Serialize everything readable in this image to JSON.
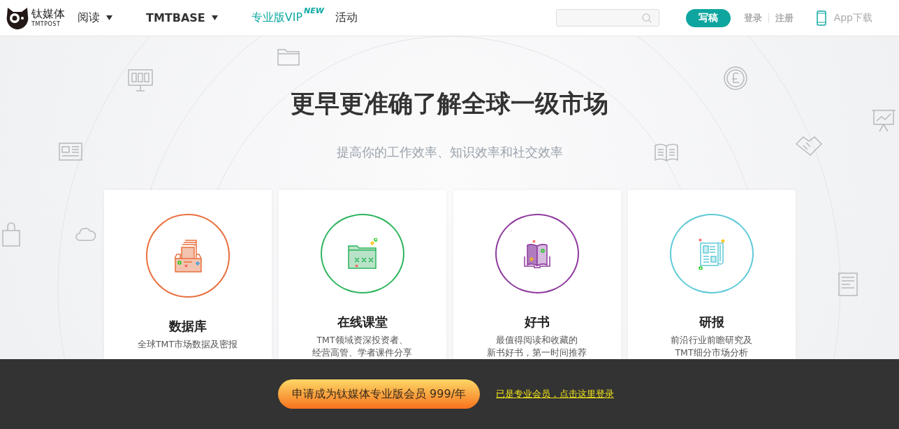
{
  "header": {
    "logo": {
      "name": "钛媒体",
      "sub": "TMTPOST"
    },
    "nav": [
      {
        "label": "阅读",
        "kind": "dropdown"
      },
      {
        "label": "TMTBASE",
        "kind": "dropdown"
      },
      {
        "label": "专业版VIP",
        "badge": "NEW",
        "kind": "highlight"
      },
      {
        "label": "活动",
        "kind": "plain"
      }
    ],
    "write_button": "写稿",
    "login": "登录",
    "register": "注册",
    "app_download": "App下载"
  },
  "hero": {
    "title": "更早更准确了解全球一级市场",
    "subtitle": "提高你的工作效率、知识效率和社交效率"
  },
  "cards": [
    {
      "kind": "database",
      "color": "#e9703e",
      "title": "数据库",
      "description": [
        "全球TMT市场数据及密报"
      ]
    },
    {
      "kind": "course",
      "color": "#2db55d",
      "title": "在线课堂",
      "description": [
        "TMT领域资深投资者、",
        "经营高管、学者课件分享"
      ]
    },
    {
      "kind": "book",
      "color": "#8e3a9d",
      "title": "好书",
      "description": [
        "最值得阅读和收藏的",
        "新书好书，第一时间推荐"
      ]
    },
    {
      "kind": "report",
      "color": "#5fcad8",
      "title": "研报",
      "description": [
        "前沿行业前瞻研究及",
        "TMT细分市场分析"
      ]
    }
  ],
  "membership_bar": {
    "apply_button": "申请成为钛媒体专业版会员 999/年",
    "login_link": "已是专业会员，点击这里登录"
  }
}
